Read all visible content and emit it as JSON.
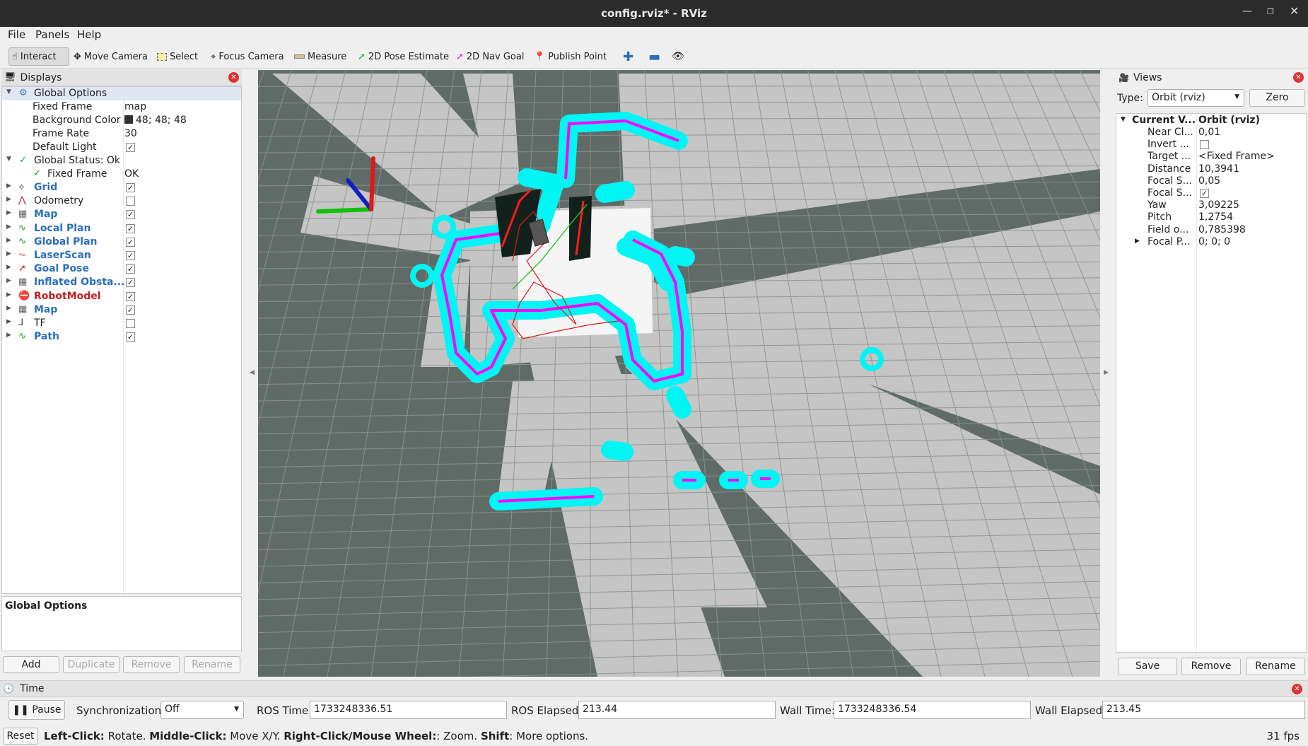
{
  "window": {
    "title": "config.rviz* - RViz"
  },
  "menu": {
    "file": "File",
    "panels": "Panels",
    "help": "Help"
  },
  "toolbar": {
    "interact": "Interact",
    "move_camera": "Move Camera",
    "select": "Select",
    "focus_camera": "Focus Camera",
    "measure": "Measure",
    "pose_estimate": "2D Pose Estimate",
    "nav_goal": "2D Nav Goal",
    "publish_point": "Publish Point"
  },
  "displays": {
    "title": "Displays",
    "global_options": "Global Options",
    "fixed_frame_label": "Fixed Frame",
    "fixed_frame_value": "map",
    "bg_color_label": "Background Color",
    "bg_color_value": "48; 48; 48",
    "frame_rate_label": "Frame Rate",
    "frame_rate_value": "30",
    "default_light_label": "Default Light",
    "global_status": "Global Status: Ok",
    "fixed_frame_status_label": "Fixed Frame",
    "fixed_frame_status_value": "OK",
    "items": [
      {
        "name": "Grid",
        "checked": true,
        "style": "blue",
        "icon": "grid-icon"
      },
      {
        "name": "Odometry",
        "checked": false,
        "style": "plain",
        "icon": "odometry-icon"
      },
      {
        "name": "Map",
        "checked": true,
        "style": "blue",
        "icon": "map-icon"
      },
      {
        "name": "Local Plan",
        "checked": true,
        "style": "blue",
        "icon": "path-icon"
      },
      {
        "name": "Global Plan",
        "checked": true,
        "style": "blue",
        "icon": "path-icon"
      },
      {
        "name": "LaserScan",
        "checked": true,
        "style": "blue",
        "icon": "laserscan-icon"
      },
      {
        "name": "Goal Pose",
        "checked": true,
        "style": "blue",
        "icon": "pose-icon"
      },
      {
        "name": "Inflated Obsta...",
        "checked": true,
        "style": "blue",
        "icon": "map-icon"
      },
      {
        "name": "RobotModel",
        "checked": true,
        "style": "red",
        "icon": "error-icon"
      },
      {
        "name": "Map",
        "checked": true,
        "style": "blue",
        "icon": "map-icon"
      },
      {
        "name": "TF",
        "checked": false,
        "style": "plain",
        "icon": "tf-icon"
      },
      {
        "name": "Path",
        "checked": true,
        "style": "blue",
        "icon": "path-icon"
      }
    ],
    "description_title": "Global Options",
    "buttons": {
      "add": "Add",
      "duplicate": "Duplicate",
      "remove": "Remove",
      "rename": "Rename"
    }
  },
  "views": {
    "title": "Views",
    "type_label": "Type:",
    "type_value": "Orbit (rviz)",
    "zero": "Zero",
    "current_key": "Current V...",
    "current_value": "Orbit (rviz)",
    "rows": [
      {
        "k": "Near Cl...",
        "v": "0,01"
      },
      {
        "k": "Invert ...",
        "v": ""
      },
      {
        "k": "Target ...",
        "v": "<Fixed Frame>"
      },
      {
        "k": "Distance",
        "v": "10,3941"
      },
      {
        "k": "Focal S...",
        "v": "0,05"
      },
      {
        "k": "Focal S...",
        "v": ""
      },
      {
        "k": "Yaw",
        "v": "3,09225"
      },
      {
        "k": "Pitch",
        "v": "1,2754"
      },
      {
        "k": "Field o...",
        "v": "0,785398"
      },
      {
        "k": "Focal P...",
        "v": "0; 0; 0"
      }
    ],
    "buttons": {
      "save": "Save",
      "remove": "Remove",
      "rename": "Rename"
    }
  },
  "time": {
    "title": "Time",
    "pause": "Pause",
    "sync_label": "Synchronization:",
    "sync_value": "Off",
    "ros_time_label": "ROS Time:",
    "ros_time": "1733248336.51",
    "ros_elapsed_label": "ROS Elapsed:",
    "ros_elapsed": "213.44",
    "wall_time_label": "Wall Time:",
    "wall_time": "1733248336.54",
    "wall_elapsed_label": "Wall Elapsed:",
    "wall_elapsed": "213.45"
  },
  "status": {
    "reset": "Reset",
    "b1": "Left-Click:",
    "t1": " Rotate. ",
    "b2": "Middle-Click:",
    "t2": " Move X/Y. ",
    "b3": "Right-Click/Mouse Wheel:",
    "t3": ": Zoom. ",
    "b4": "Shift",
    "t4": ": More options.",
    "fps": "31 fps"
  },
  "colors": {
    "laser": "#ff00ff",
    "inflation": "#00f5f5",
    "map_free": "#c5c5c5",
    "map_unknown": "#606a67",
    "obstacle": "#13211d"
  }
}
